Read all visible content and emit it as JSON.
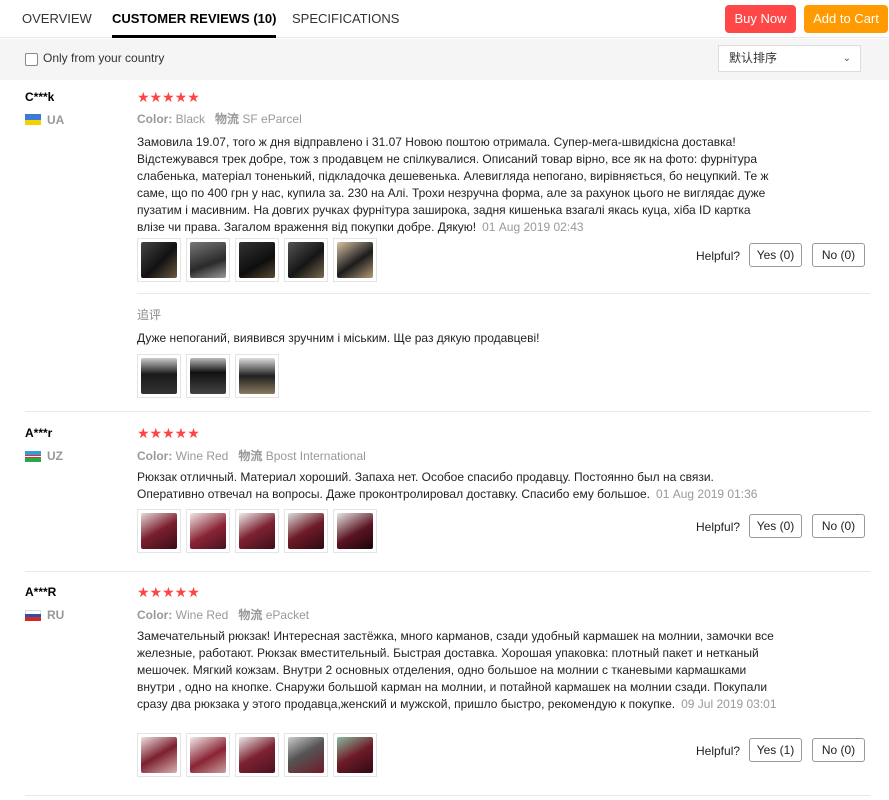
{
  "tabs": {
    "overview": "OVERVIEW",
    "reviews": "CUSTOMER REVIEWS (10)",
    "specifications": "SPECIFICATIONS"
  },
  "actions": {
    "buy_now": "Buy Now",
    "add_to_cart": "Add to Cart",
    "buy_color": "#ff4747",
    "cart_color": "#ff9a00"
  },
  "filter": {
    "country_label": "Only from your country",
    "country_checked": false,
    "sort_value": "默认排序"
  },
  "helpful_label": "Helpful?",
  "reviews": [
    {
      "user": "C***k",
      "country": "UA",
      "rating": 5,
      "stars": "★★★★★",
      "color_label": "Color:",
      "color": "Black",
      "shipping_label": "物流",
      "shipping": "SF eParcel",
      "text": "Замовила 19.07, того ж дня відправлено і 31.07 Новою поштою отримала. Супер-мега-швидкісна доставка! Відстежувався трек добре, тож з продавцем не спілкувалися. Описаний товар вірно, все як на фото: фурнітура слабенька, матеріал тоненький, підкладочка дешевенька. Алевиглядa непогано, вирівняється, бо нецупкий. Те ж саме, що по 400 грн у нас, купила за. 230 на Алі. Трохи незручна форма, але за рахунок цього не виглядає дуже пузатим і масивним. На довгих ручках фурнітура заширока, задня кишенька взагалі якась куца, хіба ID картка влізе чи права. Загалом враження від покупки добре. Дякую!",
      "date": "01 Aug 2019 02:43",
      "yes": "Yes (0)",
      "no": "No (0)",
      "followup_label": "追评",
      "followup_text": "Дуже непоганий, виявився зручним і міським. Ще раз дякую продавцеві!"
    },
    {
      "user": "A***r",
      "country": "UZ",
      "rating": 5,
      "stars": "★★★★★",
      "color_label": "Color:",
      "color": "Wine Red",
      "shipping_label": "物流",
      "shipping": "Bpost International",
      "text": "Рюкзак отличный. Материал хороший. Запаха нет. Особое спасибо продавцу. Постоянно был на связи. Оперативно отвечал на вопросы. Даже проконтролировал доставку. Спасибо ему большое.",
      "date": "01 Aug 2019 01:36",
      "yes": "Yes (0)",
      "no": "No (0)"
    },
    {
      "user": "A***R",
      "country": "RU",
      "rating": 5,
      "stars": "★★★★★",
      "color_label": "Color:",
      "color": "Wine Red",
      "shipping_label": "物流",
      "shipping": "ePacket",
      "text": "Замечательный рюкзак! Интересная застёжка, много карманов, сзади удобный кармашек на молнии, замочки все железные, работают. Рюкзак вместительный. Быстрая доставка. Хорошая упаковка: плотный пакет и нетканый мешочек. Мягкий кожзам. Внутри 2 основных отделения, одно большое на молнии с тканевыми кармашками внутри , одно на кнопке. Снаружи большой карман на молнии, и потайной кармашек на молнии сзади. Покупали сразу два рюкзака у этого продавца,женский и мужской, пришло быстро, рекомендую к покупке.",
      "date": "09 Jul 2019 03:01",
      "yes": "Yes (1)",
      "no": "No (0)"
    }
  ]
}
